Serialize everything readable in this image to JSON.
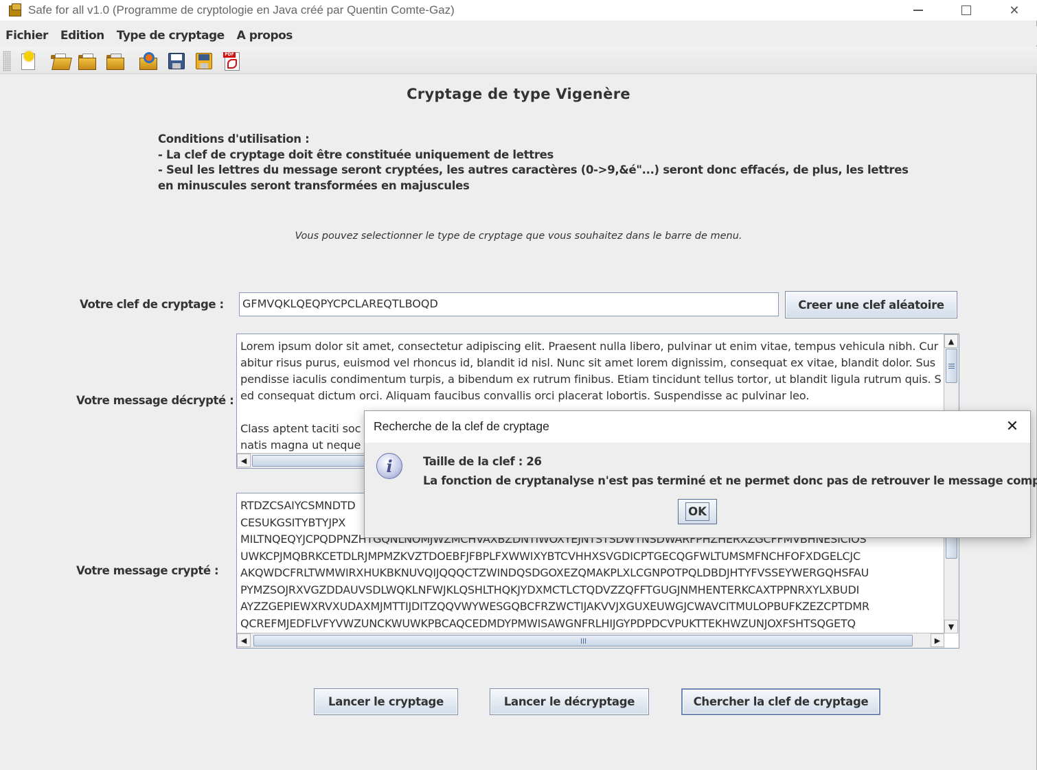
{
  "window": {
    "title": "Safe for all v1.0 (Programme de cryptologie en Java créé par Quentin Comte-Gaz)",
    "controls": {
      "minimize_icon": "minimize-icon",
      "maximize_icon": "maximize-icon",
      "close_label": "✕"
    }
  },
  "menu": {
    "items": [
      "Fichier",
      "Edition",
      "Type de cryptage",
      "A propos"
    ]
  },
  "toolbar": {
    "icons": [
      "new-document-icon",
      "open-folder-icon",
      "folder-icon",
      "folder-file-icon",
      "key-folder-icon",
      "save-icon",
      "save-as-icon",
      "pdf-icon"
    ]
  },
  "main": {
    "heading": "Cryptage de type Vigenère",
    "conditions": [
      "Conditions d'utilisation :",
      "- La clef de cryptage doit être constituée uniquement de lettres",
      "- Seul les lettres du message seront cryptées, les autres caractères (0->9,&é\"...) seront donc effacés, de plus, les lettres",
      "en minuscules seront transformées en majuscules"
    ],
    "hint": "Vous pouvez selectionner le type de cryptage que vous souhaitez dans le barre de menu.",
    "key_label": "Votre clef de cryptage :",
    "key_value": "GFMVQKLQEQPYCPCLAREQTLBOQD",
    "random_key_button": "Creer une clef aléatoire",
    "decrypted_label": "Votre message décrypté :",
    "decrypted_text": "Lorem ipsum dolor sit amet, consectetur adipiscing elit. Praesent nulla libero, pulvinar ut enim vitae, tempus vehicula nibh. Cur\nabitur risus purus, euismod vel rhoncus id, blandit id nisl. Nunc sit amet lorem dignissim, consequat ex vitae, blandit dolor. Sus\npendisse iaculis condimentum turpis, a bibendum ex rutrum finibus. Etiam tincidunt tellus tortor, ut blandit ligula rutrum quis. S\ned consequat dictum orci. Aliquam faucibus convallis orci placerat lobortis. Suspendisse ac pulvinar leo.\n\nClass aptent taciti soc\nnatis magna ut neque",
    "encrypted_label": "Votre message crypté :",
    "encrypted_text": "RTDZCSAIYCSMNDTD\nCESUKGSITYBTYJPX\nMILTNQEQYJCPQDPNZHTGQNLNOMJWZMCHVAXBZDNTIWOXYEJNTSTSDWTNSDWARFPHZHERXZGCFFMVBHNESICIOS\nUWKCPJMQBRKCETDLRJMPMZKVZTDOEBFJFBPLFXWWIXYBTCVHHXSVGDICPTGECQGFWLTUMSMFNCHFOFXDGELCJC\nAKQWDCFRLTWMWIRXHUKBKNUVQIJQQQCTZWINDQSDGOXEZQMAKPLXLCGNPOTPQLDBDJHTYFVSSEYWERGQHSFAU\nPYMZSOJRXVGZDDAUVSDLWQKLNFWJKLQSHLTHQKJYDXMCTLCTQDVZZQFFTGUGJNMHENTERKCAXTPPNRXYLXBUDI\nAYZZGEPIEWXRVXUDAXMJMTTIJDITZQQVWYWESGQBCFRZWCTIJAKVVJXGUXEUWGJCWAVCITMULOPBUFKZEZCPTDMR\nQCREFMJEDFLVFYVWZUNCKWUWKPBCAQCEDMDYPMWISAWGNFRLHIJGYPDPDCVPUKTTEKHWZUNJOXFSHTSQGETQ",
    "buttons": {
      "encrypt": "Lancer le cryptage",
      "decrypt": "Lancer le décryptage",
      "find_key": "Chercher la clef de cryptage"
    }
  },
  "dialog": {
    "title": "Recherche de la clef de cryptage",
    "close_label": "✕",
    "icon": "info-icon",
    "icon_glyph": "i",
    "line1": "Taille de la clef : 26",
    "line2": "La fonction de cryptanalyse n'est pas terminé et ne permet donc pas de retrouver le message complet",
    "ok_label": "OK"
  }
}
